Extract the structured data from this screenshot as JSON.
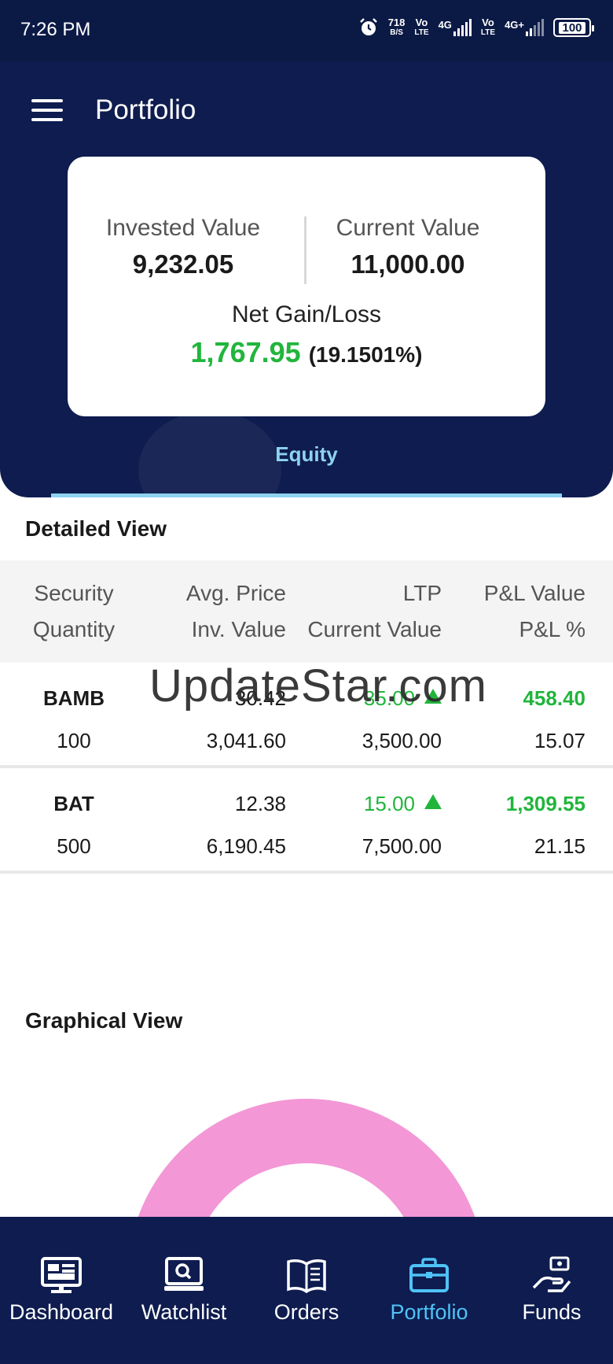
{
  "status_bar": {
    "time": "7:26 PM",
    "speed_value": "718",
    "speed_unit": "B/S",
    "sim1_volte_top": "Vo",
    "sim1_volte_bottom": "LTE",
    "sim1_net": "4G",
    "sim2_volte_top": "Vo",
    "sim2_volte_bottom": "LTE",
    "sim2_net": "4G+",
    "battery": "100",
    "icons": [
      "alarm-icon",
      "signal-icon",
      "battery-icon"
    ]
  },
  "header": {
    "title": "Portfolio",
    "background_color": "#0e1c4f"
  },
  "summary": {
    "invested_label": "Invested Value",
    "invested_value": "9,232.05",
    "current_label": "Current Value",
    "current_value": "11,000.00",
    "net_label": "Net Gain/Loss",
    "net_value": "1,767.95",
    "net_percent": "(19.1501%)",
    "gain_color": "#21b53c"
  },
  "tabs": [
    {
      "label": "Equity",
      "active": true
    }
  ],
  "detailed_view": {
    "title": "Detailed View",
    "headers": {
      "row1": [
        "Security",
        "Avg. Price",
        "LTP",
        "P&L Value"
      ],
      "row2": [
        "Quantity",
        "Inv. Value",
        "Current Value",
        "P&L %"
      ]
    },
    "rows": [
      {
        "security": "BAMB",
        "avg_price": "30.42",
        "ltp": "35.00",
        "pl_value": "458.40",
        "quantity": "100",
        "inv_value": "3,041.60",
        "current_value": "3,500.00",
        "pl_percent": "15.07",
        "trend": "up"
      },
      {
        "security": "BAT",
        "avg_price": "12.38",
        "ltp": "15.00",
        "pl_value": "1,309.55",
        "quantity": "500",
        "inv_value": "6,190.45",
        "current_value": "7,500.00",
        "pl_percent": "21.15",
        "trend": "up"
      }
    ]
  },
  "watermark": "UpdateStar.com",
  "graphical_view": {
    "title": "Graphical View",
    "chart_color": "#f397d6"
  },
  "bottom_nav": {
    "items": [
      {
        "label": "Dashboard",
        "icon": "monitor-dashboard-icon",
        "active": false
      },
      {
        "label": "Watchlist",
        "icon": "monitor-search-icon",
        "active": false
      },
      {
        "label": "Orders",
        "icon": "open-book-icon",
        "active": false
      },
      {
        "label": "Portfolio",
        "icon": "briefcase-icon",
        "active": true
      },
      {
        "label": "Funds",
        "icon": "hand-money-icon",
        "active": false
      }
    ],
    "active_color": "#4fc3f7"
  }
}
